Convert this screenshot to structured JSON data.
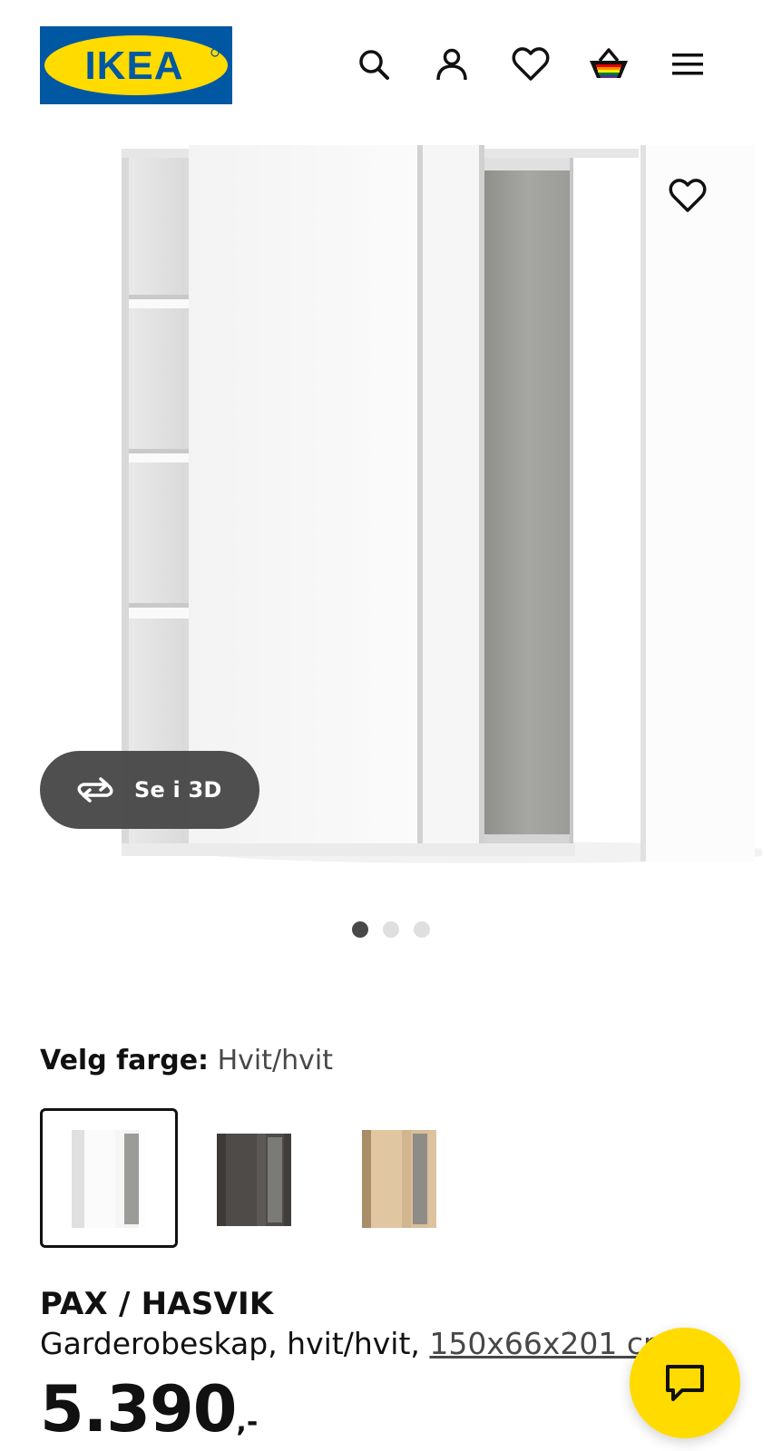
{
  "header": {
    "logo_text": "IKEA",
    "icons": [
      "search-icon",
      "account-icon",
      "favourites-icon",
      "basket-icon",
      "menu-icon"
    ]
  },
  "gallery": {
    "view_3d_label": "Se i 3D",
    "slides": 3,
    "active_slide": 1
  },
  "color": {
    "label": "Velg farge:",
    "value": "Hvit/hvit",
    "options": [
      "Hvit/hvit",
      "Mørkegrå",
      "Hvitlasert eikemønster"
    ],
    "selected_index": 0
  },
  "product": {
    "name": "PAX / HASVIK",
    "description": "Garderobeskap, hvit/hvit, ",
    "dimensions": "150x66x201 cm",
    "price": "5.390",
    "price_suffix": ",-"
  },
  "colors": {
    "ikea_blue": "#0058a3",
    "ikea_yellow": "#ffdb00",
    "chat_yellow": "#ffdb00",
    "text_dark": "#111111",
    "text_muted": "#484848"
  }
}
